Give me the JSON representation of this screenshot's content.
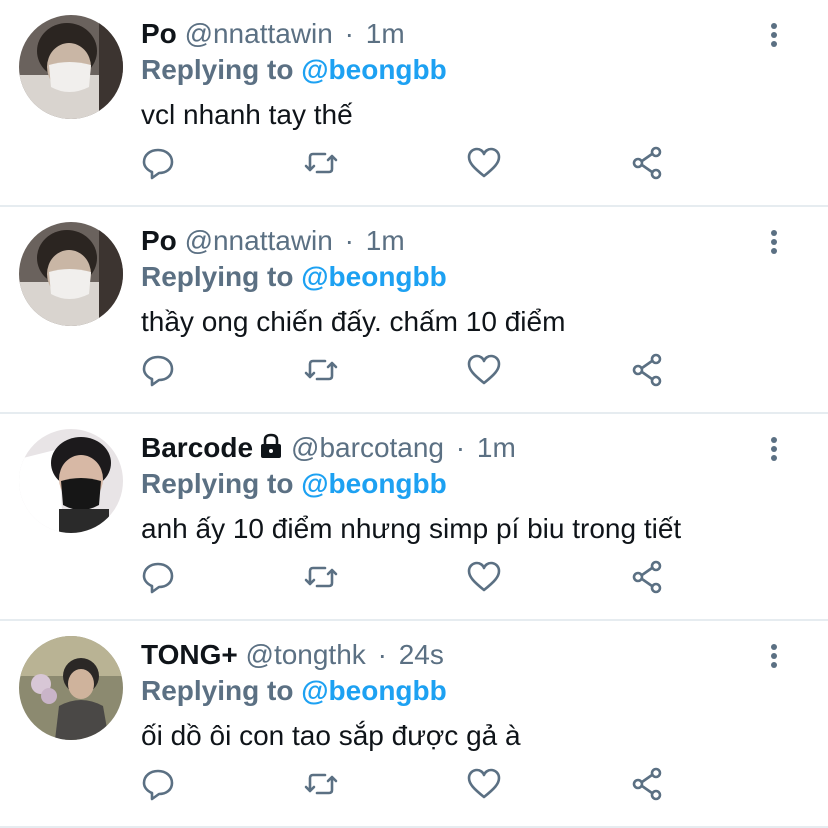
{
  "colors": {
    "text_primary": "#0f1419",
    "text_secondary": "#5b7083",
    "mention": "#1da1f2",
    "divider": "#e6ecf0"
  },
  "icons": [
    "reply-icon",
    "retweet-icon",
    "like-icon",
    "share-icon",
    "more-icon",
    "lock-icon"
  ],
  "tweets": [
    {
      "name": "Po",
      "handle": "@nnattawin",
      "separator": "·",
      "time": "1m",
      "replying_prefix": "Replying to",
      "replying_to": "@beongbb",
      "text": "vcl nhanh tay thế",
      "locked": false
    },
    {
      "name": "Po",
      "handle": "@nnattawin",
      "separator": "·",
      "time": "1m",
      "replying_prefix": "Replying to",
      "replying_to": "@beongbb",
      "text": "thầy ong chiến đấy. chấm 10 điểm",
      "locked": false
    },
    {
      "name": "Barcode",
      "handle": "@barcotang",
      "separator": "·",
      "time": "1m",
      "replying_prefix": "Replying to",
      "replying_to": "@beongbb",
      "text": "anh ấy 10 điểm nhưng simp pí biu trong tiết",
      "locked": true
    },
    {
      "name": "TONG+",
      "handle": "@tongthk",
      "separator": "·",
      "time": "24s",
      "replying_prefix": "Replying to",
      "replying_to": "@beongbb",
      "text": "ối dồ ôi con tao sắp được gả à",
      "locked": false
    }
  ]
}
